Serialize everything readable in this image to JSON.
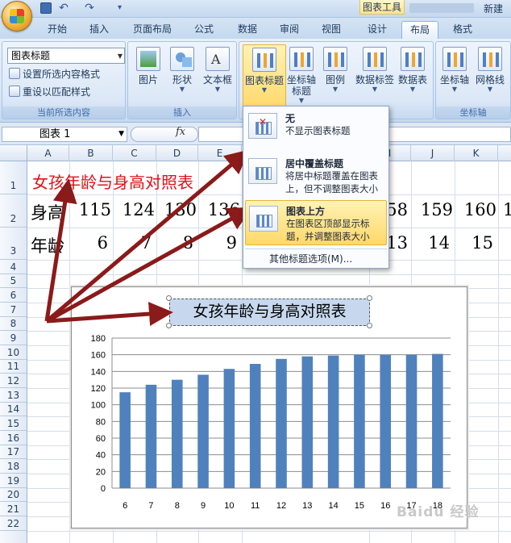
{
  "window": {
    "context_tab_title": "图表工具",
    "title_text": "新建"
  },
  "tabs": [
    "开始",
    "插入",
    "页面布局",
    "公式",
    "数据",
    "审阅",
    "视图",
    "设计",
    "布局",
    "格式"
  ],
  "active_tab": "布局",
  "ribbon": {
    "current_selection": {
      "dropdown_value": "图表标题",
      "format_selection": "设置所选内容格式",
      "reset_style": "重设以匹配样式",
      "group_label": "当前所选内容"
    },
    "insert": {
      "picture": "图片",
      "shapes": "形状",
      "textbox": "文本框",
      "group_label": "插入"
    },
    "labels": {
      "chart_title": "图表标题",
      "axis_title": "坐标轴\n标题",
      "legend": "图例",
      "data_labels": "数据标签",
      "data_table": "数据表"
    },
    "axes": {
      "axes": "坐标轴",
      "gridlines": "网格线",
      "group_label": "坐标轴"
    }
  },
  "formula_bar": {
    "name_box": "图表 1",
    "fx": "fx",
    "formula": ""
  },
  "columns": [
    "A",
    "B",
    "C",
    "D",
    "E",
    "I",
    "J",
    "K"
  ],
  "rows": [
    "1",
    "2",
    "3",
    "4",
    "5",
    "6",
    "7",
    "8",
    "9",
    "10",
    "11",
    "12",
    "13",
    "14",
    "15",
    "16",
    "17",
    "18",
    "19",
    "20",
    "21",
    "22"
  ],
  "sheet": {
    "title": "女孩年龄与身高对照表",
    "row2_label": "身高",
    "row3_label": "年龄",
    "row2_values_left": [
      "115",
      "124",
      "130",
      "136"
    ],
    "row3_values_left": [
      "6",
      "7",
      "8",
      "9"
    ],
    "row2_values_right": [
      "58",
      "159",
      "160",
      "1"
    ],
    "row3_values_right": [
      "13",
      "14",
      "15"
    ]
  },
  "chart_title": "女孩年龄与身高对照表",
  "chart_data": {
    "type": "bar",
    "title": "女孩年龄与身高对照表",
    "categories": [
      "6",
      "7",
      "8",
      "9",
      "10",
      "11",
      "12",
      "13",
      "14",
      "15",
      "16",
      "17",
      "18"
    ],
    "values": [
      115,
      124,
      130,
      136,
      143,
      149,
      155,
      158,
      159,
      160,
      160,
      160,
      161
    ],
    "ylim": [
      0,
      180
    ],
    "yticks": [
      "0",
      "20",
      "40",
      "60",
      "80",
      "100",
      "120",
      "140",
      "160",
      "180"
    ],
    "bar_color": "#4f81bd",
    "grid": true,
    "legend": "none"
  },
  "dropdown": {
    "items": [
      {
        "title": "无",
        "desc": "不显示图表标题"
      },
      {
        "title": "居中覆盖标题",
        "desc": "将居中标题覆盖在图表上，但不调整图表大小"
      },
      {
        "title": "图表上方",
        "desc": "在图表区顶部显示标题，并调整图表大小"
      }
    ],
    "more": "其他标题选项(M)..."
  },
  "watermark": "Baidu 经验",
  "colors": {
    "arrow": "#8b1a1a",
    "sheet_title": "#e0101a",
    "highlight": "#ffd86a"
  }
}
